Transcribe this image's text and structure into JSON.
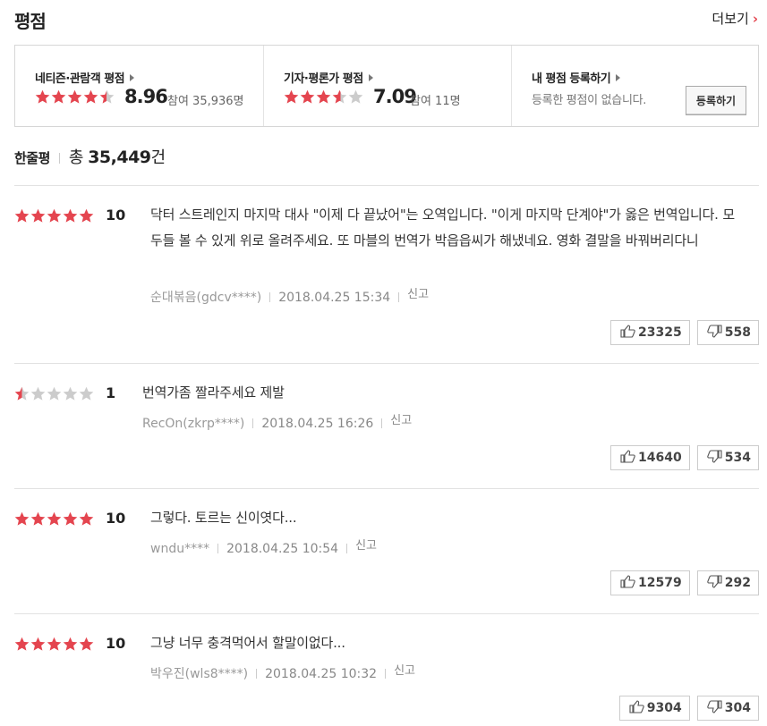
{
  "header": {
    "title": "평점",
    "more_label": "더보기"
  },
  "summary": {
    "netizen": {
      "label": "네티즌·관람객 평점",
      "score": "8.96",
      "participants": "참여 35,936명",
      "rating": 4.48
    },
    "critic": {
      "label": "기자·평론가 평점",
      "score": "7.09",
      "participants": "참여 11명",
      "rating": 3.55
    },
    "mine": {
      "label": "내 평점 등록하기",
      "empty_text": "등록한 평점이 없습니다.",
      "register_label": "등록하기"
    }
  },
  "reviews_header": {
    "label": "한줄평",
    "total_prefix": "총",
    "total_count": "35,449",
    "total_suffix": "건"
  },
  "colors": {
    "star_on": "#e4454f",
    "star_off": "#ccc",
    "accent": "#e4454f"
  },
  "reviews": [
    {
      "rating": 10,
      "score": "10",
      "text": "닥터 스트레인지 마지막 대사 \"이제 다 끝났어\"는 오역입니다. \"이게 마지막 단계야\"가 옳은 번역입니다. 모두들 볼 수 있게 위로 올려주세요. 또 마블의 번역가 박읍읍씨가 해냈네요. 영화 결말을 바꿔버리다니",
      "user": "순대볶음(gdcv****)",
      "date": "2018.04.25 15:34",
      "report": "신고",
      "likes": "23325",
      "dislikes": "558"
    },
    {
      "rating": 1,
      "score": "1",
      "text": "번역가좀 짤라주세요 제발",
      "user": "RecOn(zkrp****)",
      "date": "2018.04.25 16:26",
      "report": "신고",
      "likes": "14640",
      "dislikes": "534"
    },
    {
      "rating": 10,
      "score": "10",
      "text": "그렇다. 토르는 신이엿다...",
      "user": "wndu****",
      "date": "2018.04.25 10:54",
      "report": "신고",
      "likes": "12579",
      "dislikes": "292"
    },
    {
      "rating": 10,
      "score": "10",
      "text": "그냥 너무 충격먹어서 할말이없다...",
      "user": "박우진(wls8****)",
      "date": "2018.04.25 10:32",
      "report": "신고",
      "likes": "9304",
      "dislikes": "304"
    }
  ]
}
